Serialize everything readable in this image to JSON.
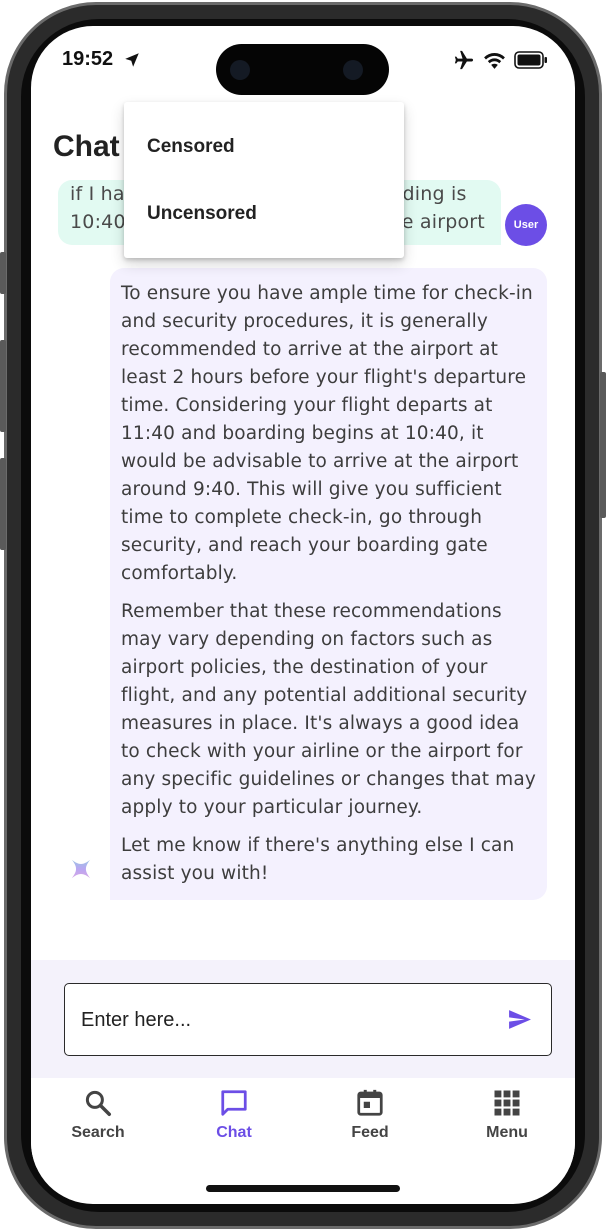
{
  "status_bar": {
    "time": "19:52",
    "icons": [
      "location-arrow-icon",
      "airplane-icon",
      "wifi-icon",
      "battery-icon"
    ]
  },
  "page": {
    "title": "Chat"
  },
  "dropdown": {
    "options": [
      "Censored",
      "Uncensored"
    ]
  },
  "messages": {
    "user": {
      "line1": "if I have a flight at 11:40 and boarding is",
      "line2": "10:40 what time should I get to the airport",
      "avatar_label": "User"
    },
    "assistant": {
      "paragraphs": [
        "To ensure you have ample time for check-in and security procedures, it is generally recommended to arrive at the airport at least 2 hours before your flight's departure time. Considering your flight departs at 11:40 and boarding begins at 10:40, it would be advisable to arrive at the airport around 9:40. This will give you sufficient time to complete check-in, go through security, and reach your boarding gate comfortably.",
        "Remember that these recommendations may vary depending on factors such as airport policies, the destination of your flight, and any potential additional security measures in place. It's always a good idea to check with your airline or the airport for any specific guidelines or changes that may apply to your particular journey.",
        "Let me know if there's anything else I can assist you with!"
      ],
      "avatar_icon": "sparkle-icon"
    }
  },
  "input": {
    "placeholder": "Enter here...",
    "send_icon": "send-icon"
  },
  "nav": {
    "items": [
      {
        "label": "Search",
        "icon": "search-icon"
      },
      {
        "label": "Chat",
        "icon": "chat-icon",
        "active": true
      },
      {
        "label": "Feed",
        "icon": "calendar-icon"
      },
      {
        "label": "Menu",
        "icon": "grid-icon"
      }
    ]
  },
  "colors": {
    "accent": "#6c4ee6",
    "user_bubble": "#e2faf2",
    "assistant_bubble": "#f4f1fe",
    "input_area": "#f4f2fb"
  }
}
